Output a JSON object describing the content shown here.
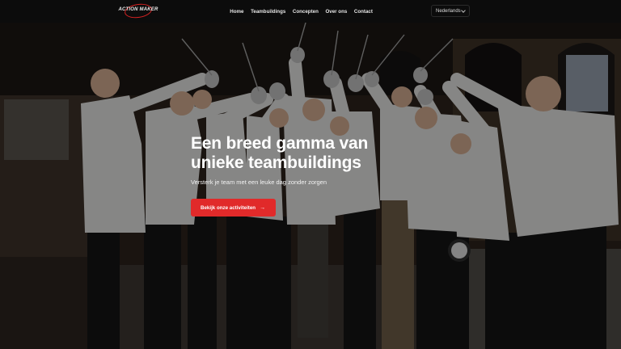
{
  "brand": {
    "logo_text": "ACTION MAKER"
  },
  "nav": {
    "items": [
      {
        "label": "Home"
      },
      {
        "label": "Teambuildings"
      },
      {
        "label": "Concepten"
      },
      {
        "label": "Over ons"
      },
      {
        "label": "Contact"
      }
    ],
    "language": {
      "selected": "Nederlands"
    }
  },
  "hero": {
    "headline_line1": "Een breed gamma van",
    "headline_line2": "unieke teambuildings",
    "subtitle": "Versterk je team met een leuke dag zonder zorgen",
    "cta_label": "Bekijk onze activiteiten",
    "cta_icon": "arrow-right-icon",
    "image": "photo of a group of fencers in white jackets raising crossed sabres"
  },
  "colors": {
    "accent": "#e12a2a",
    "nav_bg": "#0c0c0c"
  }
}
